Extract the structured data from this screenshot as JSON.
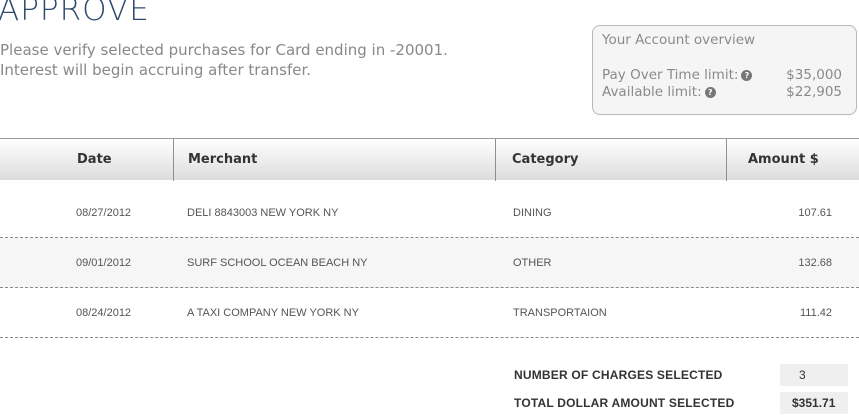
{
  "header": {
    "title": "APPROVE",
    "intro_line1": "Please verify selected purchases for Card ending in -20001.",
    "intro_line2": "Interest will begin accruing after transfer."
  },
  "overview": {
    "title": "Your Account overview",
    "rows": [
      {
        "label": "Pay Over Time limit:",
        "value": "$35,000"
      },
      {
        "label": "Available limit:",
        "value": "$22,905"
      }
    ],
    "help_glyph": "?"
  },
  "table": {
    "columns": [
      "Date",
      "Merchant",
      "Category",
      "Amount $"
    ],
    "rows": [
      {
        "date": "08/27/2012",
        "merchant": "DELI 8843003 NEW YORK NY",
        "category": "DINING",
        "amount": "107.61"
      },
      {
        "date": "09/01/2012",
        "merchant": "SURF SCHOOL OCEAN BEACH NY",
        "category": "OTHER",
        "amount": "132.68"
      },
      {
        "date": "08/24/2012",
        "merchant": "A TAXI COMPANY NEW YORK NY",
        "category": "TRANSPORTAION",
        "amount": "111.42"
      }
    ]
  },
  "summary": {
    "count_label": "NUMBER OF CHARGES SELECTED",
    "count_value": "3",
    "total_label": "TOTAL DOLLAR AMOUNT SELECTED",
    "total_value": "$351.71"
  }
}
